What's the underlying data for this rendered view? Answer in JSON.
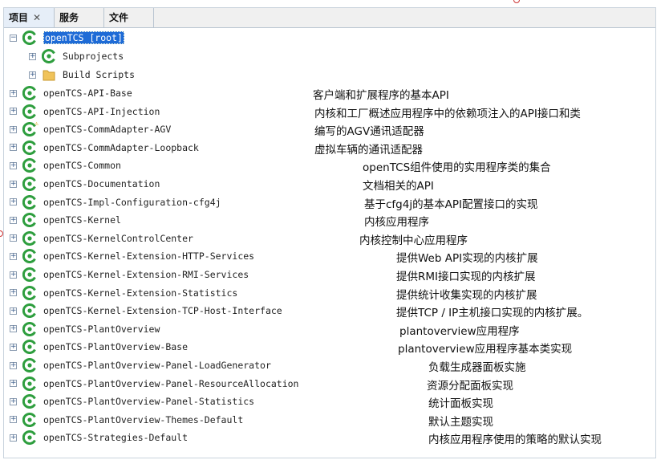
{
  "tabs": [
    {
      "label": "项目",
      "close": "✕"
    },
    {
      "label": "服务"
    },
    {
      "label": "文件"
    }
  ],
  "root": {
    "label": "openTCS [root]",
    "icon": "project-icon",
    "expanded": true
  },
  "children": [
    {
      "label": "Subprojects",
      "icon": "project-icon"
    },
    {
      "label": "Build Scripts",
      "icon": "folder-icon"
    }
  ],
  "projects": [
    {
      "label": "openTCS-API-Base",
      "desc": "客户端和扩展程序的基本API"
    },
    {
      "label": "openTCS-API-Injection",
      "desc": "内核和工厂概述应用程序中的依赖项注入的API接口和类"
    },
    {
      "label": "openTCS-CommAdapter-AGV",
      "desc": "编写的AGV通讯适配器",
      "warning": true
    },
    {
      "label": "openTCS-CommAdapter-Loopback",
      "desc": "虚拟车辆的通讯适配器"
    },
    {
      "label": "openTCS-Common",
      "desc": "openTCS组件使用的实用程序类的集合"
    },
    {
      "label": "openTCS-Documentation",
      "desc": "文档相关的API"
    },
    {
      "label": "openTCS-Impl-Configuration-cfg4j",
      "desc": "基于cfg4j的基本API配置接口的实现"
    },
    {
      "label": "openTCS-Kernel",
      "desc": "内核应用程序"
    },
    {
      "label": "openTCS-KernelControlCenter",
      "desc": "内核控制中心应用程序"
    },
    {
      "label": "openTCS-Kernel-Extension-HTTP-Services",
      "desc": "提供Web API实现的内核扩展"
    },
    {
      "label": "openTCS-Kernel-Extension-RMI-Services",
      "desc": "提供RMI接口实现的内核扩展"
    },
    {
      "label": "openTCS-Kernel-Extension-Statistics",
      "desc": "提供统计收集实现的内核扩展"
    },
    {
      "label": "openTCS-Kernel-Extension-TCP-Host-Interface",
      "desc": "提供TCP / IP主机接口实现的内核扩展。"
    },
    {
      "label": "openTCS-PlantOverview",
      "desc": "plantoverview应用程序"
    },
    {
      "label": "openTCS-PlantOverview-Base",
      "desc": "plantoverview应用程序基本类实现"
    },
    {
      "label": "openTCS-PlantOverview-Panel-LoadGenerator",
      "desc": "负载生成器面板实施"
    },
    {
      "label": "openTCS-PlantOverview-Panel-ResourceAllocation",
      "desc": "资源分配面板实现"
    },
    {
      "label": "openTCS-PlantOverview-Panel-Statistics",
      "desc": "统计面板实现"
    },
    {
      "label": "openTCS-PlantOverview-Themes-Default",
      "desc": "默认主题实现"
    },
    {
      "label": "openTCS-Strategies-Default",
      "desc": "内核应用程序使用的策略的默认实现"
    }
  ],
  "colors": {
    "selection": "#1e6bd6",
    "icon": "#2e9e3e"
  }
}
